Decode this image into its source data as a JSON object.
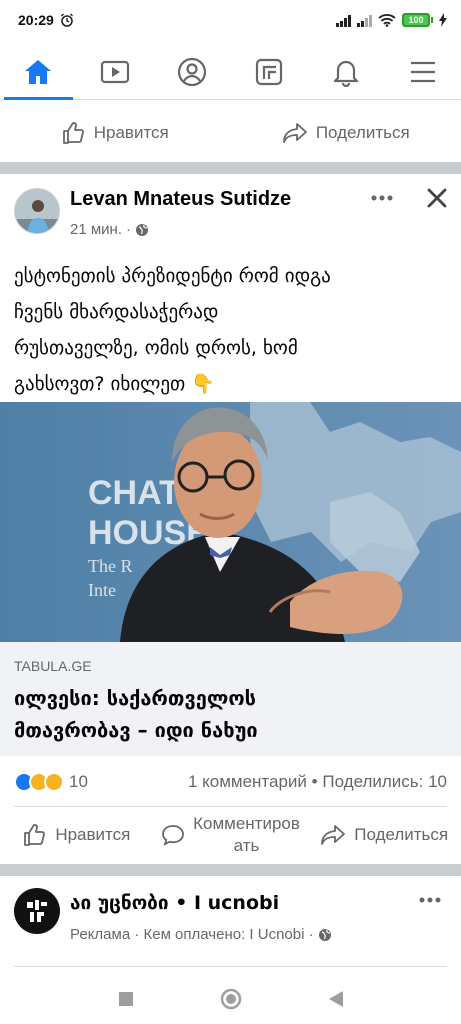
{
  "status_bar": {
    "time": "20:29",
    "battery": "100"
  },
  "nav": {
    "tabs": [
      {
        "name": "home"
      },
      {
        "name": "watch"
      },
      {
        "name": "profile"
      },
      {
        "name": "marketplace"
      },
      {
        "name": "notifications"
      },
      {
        "name": "menu"
      }
    ],
    "active_color": "#1877f2"
  },
  "prev_post_actions": {
    "like": "Нравится",
    "share": "Поделиться"
  },
  "post": {
    "author": "Levan Mnateus Sutidze",
    "time": "21 мин.",
    "text_lines": [
      "ესტონეთის პრეზიდენტი რომ იდგა",
      "ჩვენს მხარდასაჭერად",
      "რუსთაველზე, ომის დროს, ხომ",
      "გახსოვთ? იხილეთ 👇"
    ],
    "photo_sign": {
      "line1": "CHATH",
      "line2": "HOUSE",
      "line3": "The R",
      "line4": "Inte"
    },
    "link": {
      "domain": "TABULA.GE",
      "title_lines": [
        "ილვესი: საქართველოს",
        "მთავრობავ – იდი ნახუი"
      ]
    },
    "reactions_count": "10",
    "comments": "1 комментарий",
    "shares": "Поделились: 10",
    "actions": {
      "like": "Нравится",
      "comment_line1": "Комментиров",
      "comment_line2": "ать",
      "share": "Поделиться"
    }
  },
  "ad": {
    "name": "აი უცნობი • I ucnobi",
    "meta": "Реклама · Кем оплачено: I Ucnobi ·"
  }
}
